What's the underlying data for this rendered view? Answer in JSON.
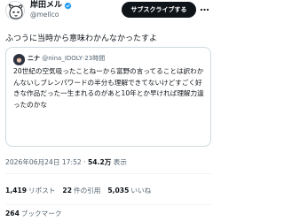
{
  "author": {
    "display_name": "岸田メル",
    "handle": "@mellco",
    "avatar_icon": "cartoon-avatar-icon",
    "verified_icon": "verified-badge-icon"
  },
  "actions": {
    "subscribe_label": "サブスクライブする",
    "more_icon": "more-dots-icon"
  },
  "tweet": {
    "text": "ふつうに当時から意味わかんなかったすよ"
  },
  "quote": {
    "display_name": "ニナ",
    "handle": "@nina_IDOLY",
    "separator": "·",
    "time": "23時間",
    "text": "20世紀の空気吸ったことねーから富野の言ってることは訳わかんないしブレンパワードの半分も理解できてないけどすごく好きな作品だった一生まれるのがあと10年とか早ければ理解力違ったのかな"
  },
  "meta": {
    "timestamp": "2026年06月24日 17:52",
    "separator": "·",
    "views_count": "54.2万",
    "views_label": "表示"
  },
  "stats": {
    "reposts_count": "1,419",
    "reposts_label": "リポスト",
    "quotes_count": "22",
    "quotes_label": "件の引用",
    "likes_count": "5,035",
    "likes_label": "いいね",
    "bookmarks_count": "264",
    "bookmarks_label": "ブックマーク"
  },
  "colors": {
    "text": "#0f1419",
    "secondary": "#536471",
    "verified": "#1d9bf0",
    "button_bg": "#0f1419",
    "border": "#cfd9de"
  }
}
